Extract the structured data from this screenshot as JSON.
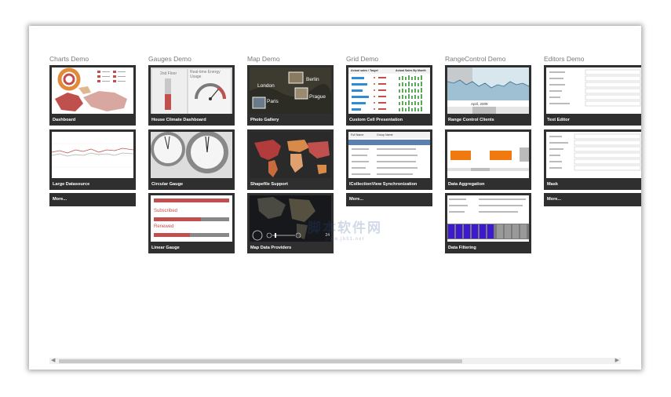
{
  "groups": [
    {
      "title": "Charts Demo"
    },
    {
      "title": "Gauges Demo"
    },
    {
      "title": "Map Demo"
    },
    {
      "title": "Grid Demo"
    },
    {
      "title": "RangeControl Demo"
    },
    {
      "title": "Editors Demo"
    }
  ],
  "tiles": {
    "charts": [
      "Dashboard",
      "Large Datasource"
    ],
    "gauges": [
      "House Climate Dashboard",
      "Circular Gauge",
      "Linear Gauge"
    ],
    "map": [
      "Photo Gallery",
      "Shapefile Support",
      "Map Data Providers"
    ],
    "grid": [
      "Custom Cell Presentation",
      "ICollectionView Synchronization"
    ],
    "range": [
      "Range Control Clients",
      "Data Aggregation",
      "Data Filtering"
    ],
    "editors": [
      "Text Editor",
      "Mask"
    ]
  },
  "more_label": "More...",
  "thumb_text": {
    "second_floor": "2nd Floor",
    "energy_usage": "Real-time Energy Usage",
    "london": "London",
    "berlin": "Berlin",
    "paris": "Paris",
    "prague": "Prague",
    "subscribed": "Subscribed",
    "renewed": "Renewed",
    "april_2009": "April, 2009",
    "grid_head_1": "Actual sales / Target",
    "grid_head_2": "Actual Sales By Month",
    "grid2_head_1": "Full Name",
    "grid2_head_2": "Group Name",
    "map_scale": "24"
  },
  "watermark": {
    "main": "脚本软件网",
    "sub": "www.jb51.net"
  },
  "colors": {
    "tile_bg": "#2f2f2f",
    "accent_red": "#b23b3b",
    "accent_orange": "#f07a10",
    "accent_blue": "#2e8bd6",
    "accent_green": "#5aa85a",
    "accent_purple": "#3b1ad0"
  }
}
